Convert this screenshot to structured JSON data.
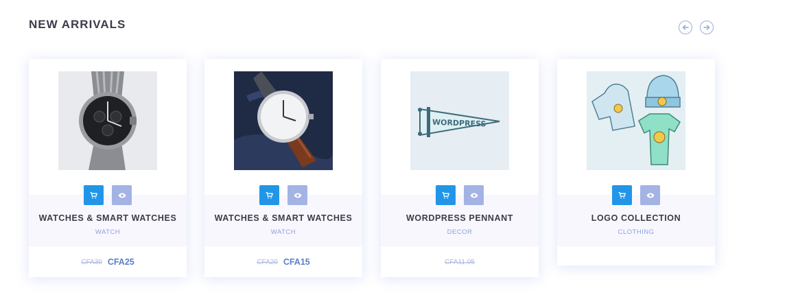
{
  "section": {
    "title": "NEW ARRIVALS",
    "prev_icon": "arrow-left-icon",
    "next_icon": "arrow-right-icon"
  },
  "products": [
    {
      "title": "WATCHES & SMART WATCHES",
      "category": "WATCH",
      "price_old": "CFA30",
      "price_new": "CFA25",
      "image": "chronograph-watch"
    },
    {
      "title": "WATCHES & SMART WATCHES",
      "category": "WATCH",
      "price_old": "CFA20",
      "price_new": "CFA15",
      "image": "leather-strap-watch"
    },
    {
      "title": "WORDPRESS PENNANT",
      "category": "DECOR",
      "price_old": "CFA11.05",
      "image": "pennant",
      "pennant_text": "WORDPRESS"
    },
    {
      "title": "LOGO COLLECTION",
      "category": "CLOTHING",
      "image": "clothing-set"
    }
  ],
  "colors": {
    "cart_button": "#2196e8",
    "view_button": "#a3b3e3",
    "accent": "#5d7ec8"
  }
}
